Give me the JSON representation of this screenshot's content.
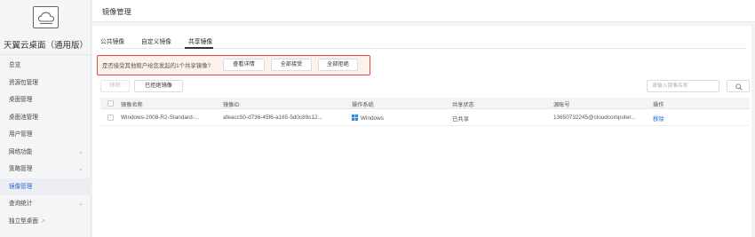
{
  "sidebar": {
    "brand": "天翼云桌面（通用版）",
    "items": [
      {
        "label": "总览",
        "has_chevron": false
      },
      {
        "label": "资源包管理",
        "has_chevron": false
      },
      {
        "label": "桌面管理",
        "has_chevron": false
      },
      {
        "label": "桌面池管理",
        "has_chevron": false
      },
      {
        "label": "用户管理",
        "has_chevron": false
      },
      {
        "label": "网络功能",
        "has_chevron": true
      },
      {
        "label": "策略管理",
        "has_chevron": true
      },
      {
        "label": "镜像管理",
        "has_chevron": false,
        "active": true
      },
      {
        "label": "查询统计",
        "has_chevron": true
      },
      {
        "label": "独立型桌面",
        "external": true
      }
    ]
  },
  "header": {
    "title": "镜像管理"
  },
  "tabs": [
    {
      "label": "公共镜像"
    },
    {
      "label": "自定义镜像"
    },
    {
      "label": "共享镜像",
      "active": true
    }
  ],
  "notice": {
    "text": "是否接受其他租户给您发起的1个共享镜像?",
    "view_details": "查看详情",
    "accept_all": "全部接受",
    "reject_all": "全部拒绝"
  },
  "toolbar": {
    "remove_label": "移除",
    "rejected_label": "已拒绝镜像",
    "search_placeholder": "请输入镜像名称"
  },
  "table": {
    "columns": [
      "镜像名称",
      "镜像ID",
      "操作系统",
      "共享状态",
      "源账号",
      "操作"
    ],
    "rows": [
      {
        "name": "Windows-2008-R2-Standard-...",
        "id": "afeacc50-d736-45f6-a165-5d0c89c12...",
        "os": "Windows",
        "status": "已共享",
        "source": "13650732245@cloudcomputer...",
        "action": "移除"
      }
    ]
  },
  "colors": {
    "accent": "#1e6ad4",
    "notice_border": "#e8473a",
    "notice_bg": "#fdf1ec",
    "windows_blue": "#2d8ce6"
  }
}
